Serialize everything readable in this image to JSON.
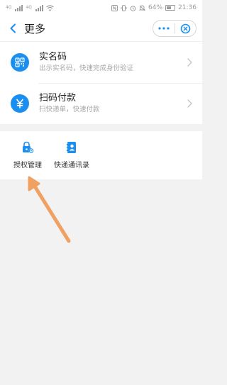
{
  "status_bar": {
    "signal_tag_1": "4G",
    "signal_tag_2": "4G",
    "battery_percent": "64%",
    "time": "21:36"
  },
  "header": {
    "title": "更多",
    "back_icon": "chevron-left-icon",
    "more_icon": "more-dots-icon",
    "close_icon": "close-circle-icon"
  },
  "services": [
    {
      "name": "实名码",
      "description": "出示实名码，快速完成身份验证",
      "icon": "qr-code-icon"
    },
    {
      "name": "扫码付款",
      "description": "扫快递单，快速付款",
      "icon": "yuan-icon"
    }
  ],
  "tools": [
    {
      "label": "授权管理",
      "icon": "lock-settings-icon"
    },
    {
      "label": "快递通讯录",
      "icon": "contacts-book-icon"
    }
  ],
  "colors": {
    "accent": "#1a8ff0",
    "annotation_arrow": "#f0a060",
    "background": "#f2f2f2"
  }
}
